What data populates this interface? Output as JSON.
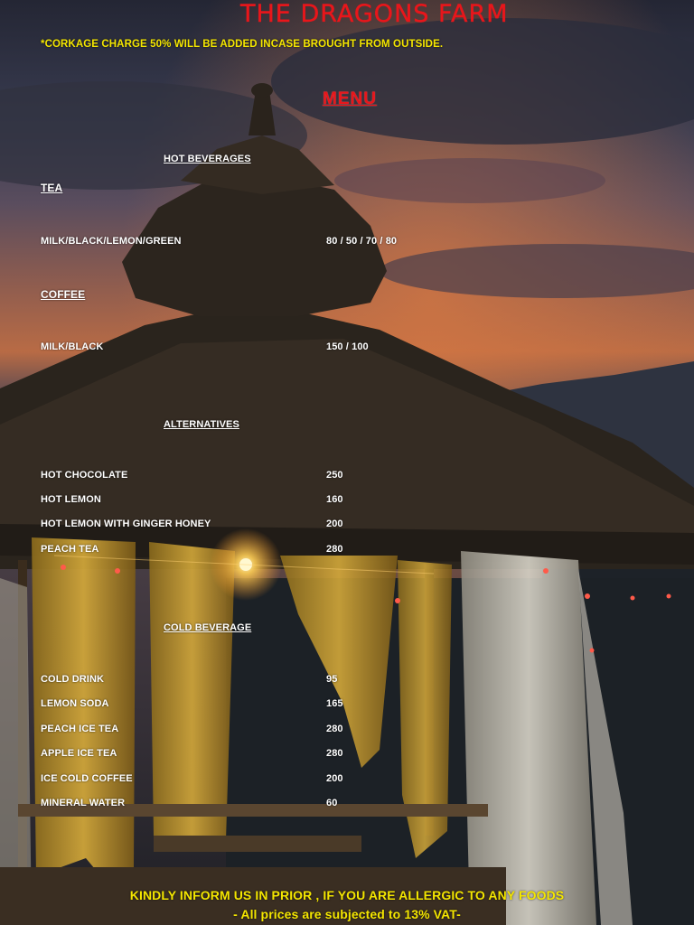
{
  "title": "THE DRAGONS FARM",
  "corkage_note": "*CORKAGE CHARGE 50% WILL BE ADDED INCASE BROUGHT FROM OUTSIDE.",
  "menu_heading": "MENU",
  "hot_beverages": {
    "heading": "HOT BEVERAGES",
    "tea": {
      "heading": "TEA",
      "items": [
        {
          "name": "MILK/BLACK/LEMON/GREEN",
          "price": "80 / 50 / 70 / 80"
        }
      ]
    },
    "coffee": {
      "heading": "COFFEE",
      "items": [
        {
          "name": "MILK/BLACK",
          "price": "150 / 100"
        }
      ]
    }
  },
  "alternatives": {
    "heading": "ALTERNATIVES",
    "items": [
      {
        "name": "HOT CHOCOLATE",
        "price": "250"
      },
      {
        "name": "HOT LEMON",
        "price": "160"
      },
      {
        "name": "HOT LEMON WITH GINGER HONEY",
        "price": "200"
      },
      {
        "name": "PEACH TEA",
        "price": "280"
      }
    ]
  },
  "cold_beverage": {
    "heading": "COLD BEVERAGE",
    "items": [
      {
        "name": "COLD DRINK",
        "price": "95"
      },
      {
        "name": "LEMON SODA",
        "price": "165"
      },
      {
        "name": "PEACH ICE TEA",
        "price": "280"
      },
      {
        "name": "APPLE ICE TEA",
        "price": "280"
      },
      {
        "name": "ICE COLD COFFEE",
        "price": "200"
      },
      {
        "name": "MINERAL WATER",
        "price": "60"
      }
    ]
  },
  "footer": {
    "allergy_note": "KINDLY INFORM US IN PRIOR , IF YOU ARE ALLERGIC TO ANY FOODS",
    "vat_note": "- All prices are subjected to 13% VAT-"
  },
  "colors": {
    "title": "#e8161b",
    "notes": "#f4e600",
    "body_text": "#ffffff"
  }
}
